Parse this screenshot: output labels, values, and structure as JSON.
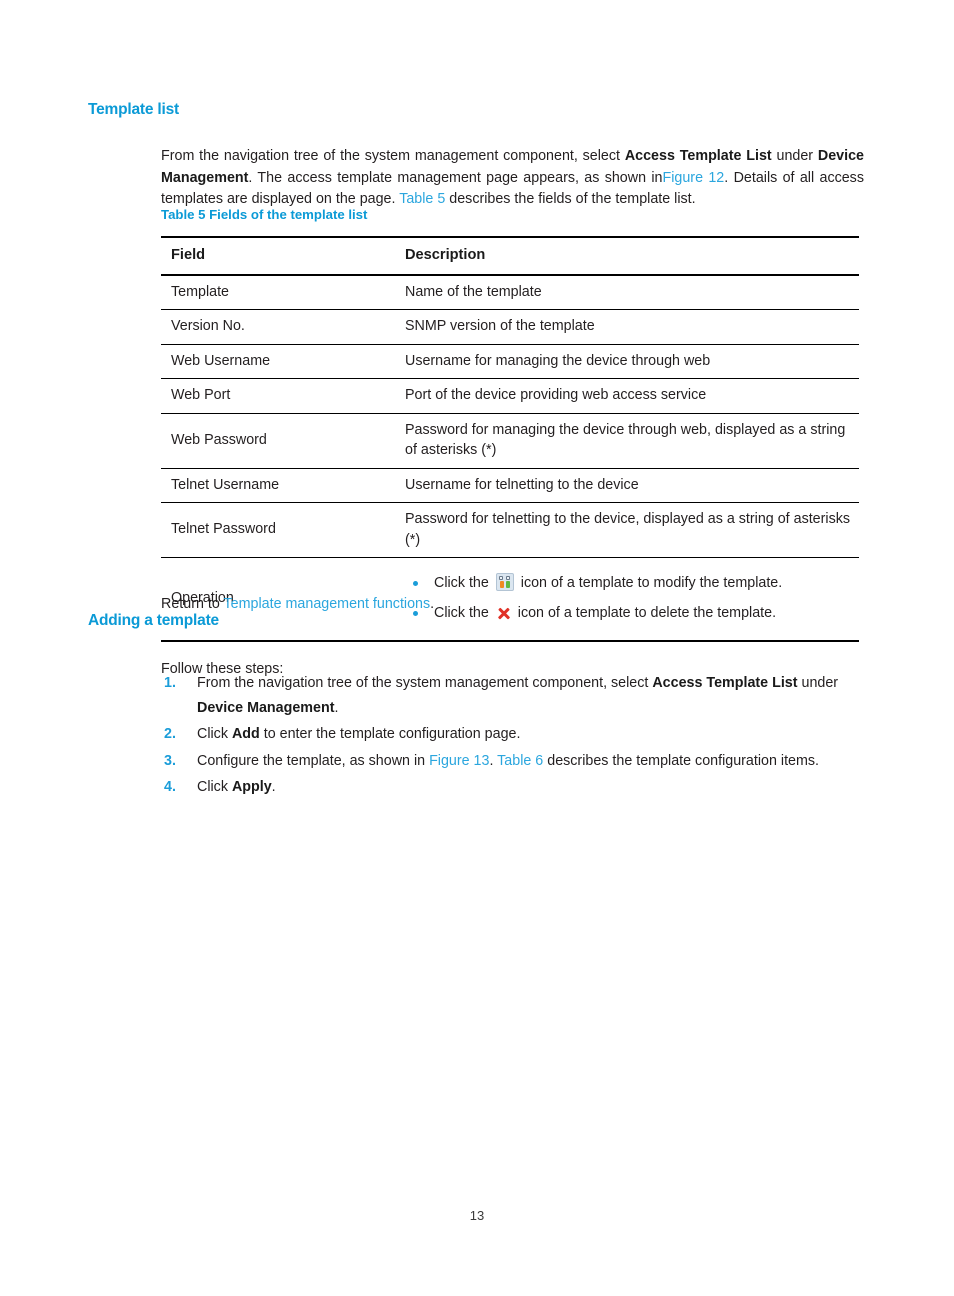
{
  "document": {
    "page_number": "13",
    "accent_heading_color": "#0b9ad6",
    "link_color": "#2ba6de",
    "bullet_color": "#1b9dd9"
  },
  "section_template_list": {
    "heading": "Template list",
    "intro": {
      "part1": "From the navigation tree of the system management component, select ",
      "bold1": "Access Template List",
      "part2": " under ",
      "bold2": "Device Management",
      "part3": ". The access template management page appears, as shown in",
      "link1": "Figure 12",
      "part4": ". Details of all access templates are displayed on the page. ",
      "link2": "Table 5",
      "part5": " describes the fields of the template list."
    },
    "return_line": {
      "prefix": "Return to ",
      "link": "Template management functions",
      "suffix": "."
    }
  },
  "table5": {
    "caption": "Table 5 Fields of the template list",
    "columns": [
      "Field",
      "Description"
    ],
    "rows": [
      {
        "field": "Template",
        "description": "Name of the template"
      },
      {
        "field": "Version No.",
        "description": "SNMP version of the template"
      },
      {
        "field": "Web Username",
        "description": "Username for managing the device through web"
      },
      {
        "field": "Web Port",
        "description": "Port of the device providing web access service"
      },
      {
        "field": "Web Password",
        "description": "Password for managing the device through web, displayed as a string of asterisks (*)"
      },
      {
        "field": "Telnet Username",
        "description": "Username for telnetting to the device"
      },
      {
        "field": "Telnet Password",
        "description": "Password for telnetting to the device, displayed as a string of asterisks (*)"
      }
    ],
    "operation_row": {
      "field": "Operation",
      "items": [
        {
          "prefix": "Click the ",
          "icon": "modify-template-icon",
          "suffix": " icon of a template to modify the template."
        },
        {
          "prefix": "Click the ",
          "icon": "delete-template-icon",
          "suffix": " icon of a template to delete the template."
        }
      ]
    }
  },
  "section_adding_template": {
    "heading": "Adding a template",
    "follow_line": "Follow these steps:",
    "steps": [
      {
        "num": "1.",
        "part1": "From the navigation tree of the system management component, select ",
        "bold1": "Access Template List",
        "part2": " under ",
        "bold2": "Device Management",
        "part3": "."
      },
      {
        "num": "2.",
        "part1": "Click ",
        "bold1": "Add",
        "part2": " to enter the template configuration page."
      },
      {
        "num": "3.",
        "part1": "Configure the template, as shown in ",
        "link1": "Figure 13",
        "part2": ". ",
        "link2": "Table 6",
        "part3": " describes the template configuration items."
      },
      {
        "num": "4.",
        "part1": "Click ",
        "bold1": "Apply",
        "part2": "."
      }
    ]
  }
}
